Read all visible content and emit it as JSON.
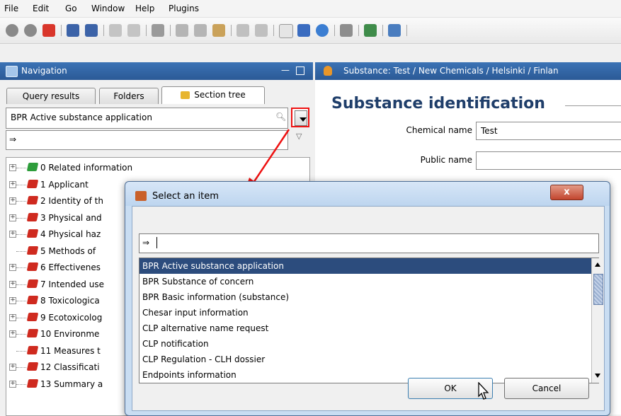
{
  "menu": {
    "items": [
      {
        "label": "File"
      },
      {
        "label": "Edit"
      },
      {
        "label": "Go"
      },
      {
        "label": "Window"
      },
      {
        "label": "Help"
      },
      {
        "label": "Plugins"
      }
    ]
  },
  "toolbar": {
    "icons": [
      "back-icon",
      "forward-icon",
      "home-icon",
      "save-icon",
      "save-all-icon",
      "edit-icon",
      "preview-icon",
      "print-icon",
      "cut-icon",
      "copy-icon",
      "paste-icon",
      "undo-icon",
      "redo-icon",
      "new-document-icon",
      "info-icon",
      "help-icon",
      "link-icon",
      "search-icon",
      "validate-icon"
    ]
  },
  "navigation": {
    "title": "Navigation",
    "tabs": [
      {
        "label": "Query results"
      },
      {
        "label": "Folders"
      },
      {
        "label": "Section tree"
      }
    ],
    "selected_type": "BPR Active substance application",
    "tree": [
      {
        "label": "0 Related information",
        "color": "#2e9d3b",
        "expandable": true
      },
      {
        "label": "1 Applicant",
        "color": "#cf2a1f",
        "expandable": true
      },
      {
        "label": "2 Identity of th",
        "color": "#cf2a1f",
        "expandable": true
      },
      {
        "label": "3 Physical and",
        "color": "#cf2a1f",
        "expandable": true
      },
      {
        "label": "4 Physical haz",
        "color": "#cf2a1f",
        "expandable": true
      },
      {
        "label": "5 Methods of",
        "color": "#cf2a1f",
        "expandable": false
      },
      {
        "label": "6 Effectivenes",
        "color": "#cf2a1f",
        "expandable": true
      },
      {
        "label": "7 Intended use",
        "color": "#cf2a1f",
        "expandable": true
      },
      {
        "label": "8 Toxicologica",
        "color": "#cf2a1f",
        "expandable": true
      },
      {
        "label": "9 Ecotoxicolog",
        "color": "#cf2a1f",
        "expandable": true
      },
      {
        "label": "10 Environme",
        "color": "#cf2a1f",
        "expandable": true
      },
      {
        "label": "11 Measures t",
        "color": "#cf2a1f",
        "expandable": false
      },
      {
        "label": "12 Classificati",
        "color": "#cf2a1f",
        "expandable": true
      },
      {
        "label": "13 Summary a",
        "color": "#cf2a1f",
        "expandable": true
      }
    ]
  },
  "substance": {
    "header": "Substance: Test  / New Chemicals / Helsinki / Finlan",
    "section_title": "Substance identification",
    "chemical_name_label": "Chemical name",
    "chemical_name_value": "Test",
    "public_name_label": "Public name",
    "public_name_value": ""
  },
  "dialog": {
    "title": "Select an item",
    "close_label": "x",
    "search_value": "",
    "items": [
      "BPR Active substance application",
      "BPR Substance of concern",
      "BPR Basic information (substance)",
      "Chesar input information",
      "CLP alternative name request",
      "CLP notification",
      "CLP Regulation - CLH dossier",
      "Endpoints information"
    ],
    "selected_index": 0,
    "ok_label": "OK",
    "cancel_label": "Cancel"
  },
  "colors": {
    "panel_header": "#2f62a3",
    "selection": "#2c4c7d",
    "annotation": "#e11"
  }
}
